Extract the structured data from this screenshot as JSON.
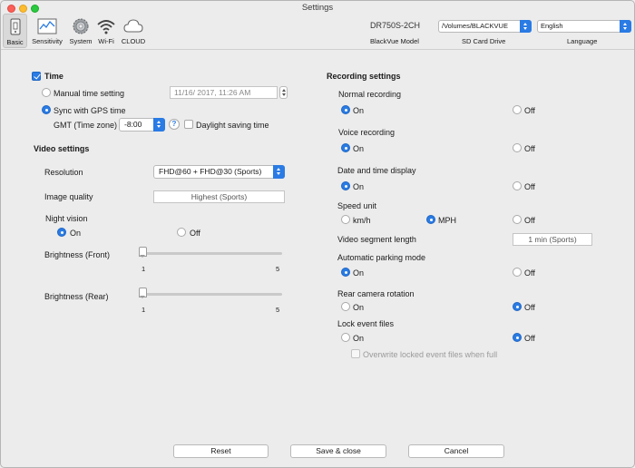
{
  "window": {
    "title": "Settings"
  },
  "toolbar": {
    "items": [
      {
        "label": "Basic",
        "icon": "basic-icon"
      },
      {
        "label": "Sensitivity",
        "icon": "chart-icon"
      },
      {
        "label": "System",
        "icon": "gear-icon"
      },
      {
        "label": "Wi-Fi",
        "icon": "wifi-icon"
      },
      {
        "label": "CLOUD",
        "icon": "cloud-icon"
      }
    ],
    "model": "DR750S-2CH",
    "model_label": "BlackVue Model",
    "sd_card_value": "/Volumes/BLACKVUE",
    "sd_card_label": "SD Card Drive",
    "language_value": "English",
    "language_label": "Language"
  },
  "time": {
    "section_title": "Time",
    "manual_label": "Manual time setting",
    "manual_value": "11/16/ 2017, 11:26 AM",
    "gps_label": "Sync with GPS time",
    "gmt_label": "GMT (Time zone)",
    "gmt_value": "-8:00",
    "help_glyph": "?",
    "dst_label": "Daylight saving time"
  },
  "video": {
    "section_title": "Video settings",
    "resolution_label": "Resolution",
    "resolution_value": "FHD@60 + FHD@30 (Sports)",
    "quality_label": "Image quality",
    "quality_value": "Highest (Sports)",
    "night_label": "Night vision",
    "on_label": "On",
    "off_label": "Off",
    "brightness_front_label": "Brightness (Front)",
    "brightness_front_value": 1,
    "brightness_rear_label": "Brightness (Rear)",
    "brightness_rear_value": 1,
    "slider_min": "1",
    "slider_max": "5"
  },
  "recording": {
    "section_title": "Recording settings",
    "normal_label": "Normal recording",
    "voice_label": "Voice recording",
    "datetime_label": "Date and time display",
    "speed_label": "Speed unit",
    "speed_kmh": "km/h",
    "speed_mph": "MPH",
    "speed_off": "Off",
    "segment_label": "Video segment length",
    "segment_value": "1 min (Sports)",
    "parking_label": "Automatic parking mode",
    "rear_rotation_label": "Rear camera rotation",
    "lock_label": "Lock event files",
    "overwrite_label": "Overwrite locked event files when full",
    "on_label": "On",
    "off_label": "Off"
  },
  "buttons": {
    "reset": "Reset",
    "save": "Save & close",
    "cancel": "Cancel"
  },
  "colors": {
    "accent": "#2a7be4"
  }
}
